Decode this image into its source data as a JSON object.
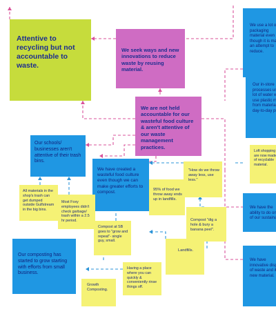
{
  "colors": {
    "lime": "#c6dc3c",
    "pink": "#cf6cc3",
    "blue": "#1f97e3",
    "yellow": "#f5f275",
    "text": "#1c2d8f",
    "connector_pink": "#d9519a",
    "connector_blue": "#2a93d8"
  },
  "notes": {
    "lime_accountable": "Attentive to recycling but not accountable to waste.",
    "pink_innovations": "We seek ways and new innovations to reduce waste by reusing material.",
    "pink_not_accountable": "We are not held accountable for our wasteful food culture & aren't attentive of our waste management practices.",
    "blue_schools": "Our schools/ businesses aren't attentive of their trash bins.",
    "blue_food_culture": "We have created a wasteful food culture even though we can make greater efforts to compost.",
    "blue_composting": "Our composting has started to grow starting with efforts from small business.",
    "blue_top_right": "We use a lot of packaging material even though it is make an attempt to reduce.",
    "blue_mid_right": "Our in-store processes use a lot of water we use plastic made from materials day-to-day pr",
    "blue_low_right": "We have the ability to do on all of our sustainable",
    "blue_bottom_right": "We have innovative dispose of waste and it to new material.",
    "y_all_materials": "All materials in the shop's trash can get dumped outside Gulfstream in the big bins.",
    "y_foxy": "Most Foxy employees didn't check garbage/ trash within a 2.5 hr period.",
    "y_throw_away": "\"How do we throw away less, use less.\"",
    "y_95_percent": "95% of food we throw away ends up in landfills.",
    "y_compost_dig": "Compost \"dig a hole & bury a banana peel\".",
    "y_compost_sb": "Compost at SB goes to \"grow and repeat\"- single guy, small.",
    "y_rinse": "Having a place where you can quickly & conveniently rinse things off.",
    "y_landfills": "Landfills.",
    "y_growth": "Growth Composting.",
    "y_loft": "Loft shopping bags are now made out of recyclable material."
  }
}
